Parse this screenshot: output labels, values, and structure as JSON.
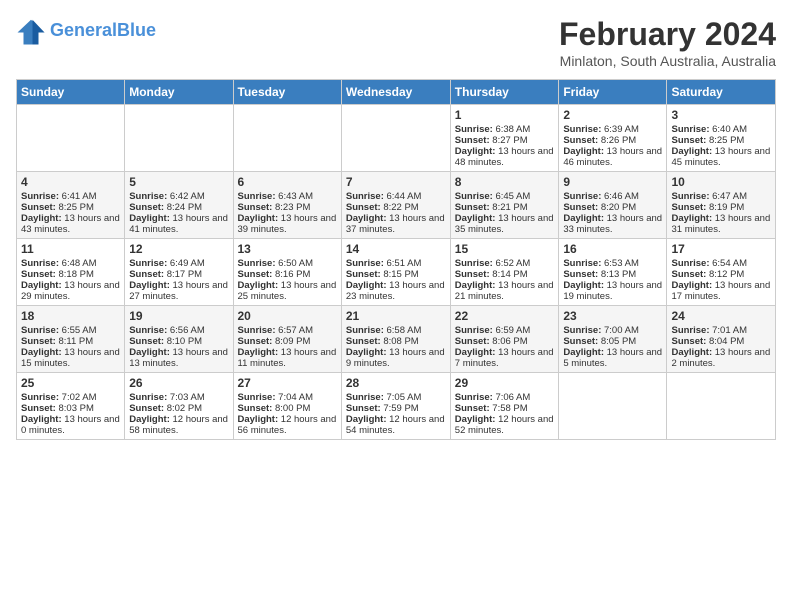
{
  "header": {
    "logo_line1": "General",
    "logo_line2": "Blue",
    "month": "February 2024",
    "location": "Minlaton, South Australia, Australia"
  },
  "days_of_week": [
    "Sunday",
    "Monday",
    "Tuesday",
    "Wednesday",
    "Thursday",
    "Friday",
    "Saturday"
  ],
  "weeks": [
    [
      {
        "day": "",
        "info": ""
      },
      {
        "day": "",
        "info": ""
      },
      {
        "day": "",
        "info": ""
      },
      {
        "day": "",
        "info": ""
      },
      {
        "day": "1",
        "info": "Sunrise: 6:38 AM\nSunset: 8:27 PM\nDaylight: 13 hours and 48 minutes."
      },
      {
        "day": "2",
        "info": "Sunrise: 6:39 AM\nSunset: 8:26 PM\nDaylight: 13 hours and 46 minutes."
      },
      {
        "day": "3",
        "info": "Sunrise: 6:40 AM\nSunset: 8:25 PM\nDaylight: 13 hours and 45 minutes."
      }
    ],
    [
      {
        "day": "4",
        "info": "Sunrise: 6:41 AM\nSunset: 8:25 PM\nDaylight: 13 hours and 43 minutes."
      },
      {
        "day": "5",
        "info": "Sunrise: 6:42 AM\nSunset: 8:24 PM\nDaylight: 13 hours and 41 minutes."
      },
      {
        "day": "6",
        "info": "Sunrise: 6:43 AM\nSunset: 8:23 PM\nDaylight: 13 hours and 39 minutes."
      },
      {
        "day": "7",
        "info": "Sunrise: 6:44 AM\nSunset: 8:22 PM\nDaylight: 13 hours and 37 minutes."
      },
      {
        "day": "8",
        "info": "Sunrise: 6:45 AM\nSunset: 8:21 PM\nDaylight: 13 hours and 35 minutes."
      },
      {
        "day": "9",
        "info": "Sunrise: 6:46 AM\nSunset: 8:20 PM\nDaylight: 13 hours and 33 minutes."
      },
      {
        "day": "10",
        "info": "Sunrise: 6:47 AM\nSunset: 8:19 PM\nDaylight: 13 hours and 31 minutes."
      }
    ],
    [
      {
        "day": "11",
        "info": "Sunrise: 6:48 AM\nSunset: 8:18 PM\nDaylight: 13 hours and 29 minutes."
      },
      {
        "day": "12",
        "info": "Sunrise: 6:49 AM\nSunset: 8:17 PM\nDaylight: 13 hours and 27 minutes."
      },
      {
        "day": "13",
        "info": "Sunrise: 6:50 AM\nSunset: 8:16 PM\nDaylight: 13 hours and 25 minutes."
      },
      {
        "day": "14",
        "info": "Sunrise: 6:51 AM\nSunset: 8:15 PM\nDaylight: 13 hours and 23 minutes."
      },
      {
        "day": "15",
        "info": "Sunrise: 6:52 AM\nSunset: 8:14 PM\nDaylight: 13 hours and 21 minutes."
      },
      {
        "day": "16",
        "info": "Sunrise: 6:53 AM\nSunset: 8:13 PM\nDaylight: 13 hours and 19 minutes."
      },
      {
        "day": "17",
        "info": "Sunrise: 6:54 AM\nSunset: 8:12 PM\nDaylight: 13 hours and 17 minutes."
      }
    ],
    [
      {
        "day": "18",
        "info": "Sunrise: 6:55 AM\nSunset: 8:11 PM\nDaylight: 13 hours and 15 minutes."
      },
      {
        "day": "19",
        "info": "Sunrise: 6:56 AM\nSunset: 8:10 PM\nDaylight: 13 hours and 13 minutes."
      },
      {
        "day": "20",
        "info": "Sunrise: 6:57 AM\nSunset: 8:09 PM\nDaylight: 13 hours and 11 minutes."
      },
      {
        "day": "21",
        "info": "Sunrise: 6:58 AM\nSunset: 8:08 PM\nDaylight: 13 hours and 9 minutes."
      },
      {
        "day": "22",
        "info": "Sunrise: 6:59 AM\nSunset: 8:06 PM\nDaylight: 13 hours and 7 minutes."
      },
      {
        "day": "23",
        "info": "Sunrise: 7:00 AM\nSunset: 8:05 PM\nDaylight: 13 hours and 5 minutes."
      },
      {
        "day": "24",
        "info": "Sunrise: 7:01 AM\nSunset: 8:04 PM\nDaylight: 13 hours and 2 minutes."
      }
    ],
    [
      {
        "day": "25",
        "info": "Sunrise: 7:02 AM\nSunset: 8:03 PM\nDaylight: 13 hours and 0 minutes."
      },
      {
        "day": "26",
        "info": "Sunrise: 7:03 AM\nSunset: 8:02 PM\nDaylight: 12 hours and 58 minutes."
      },
      {
        "day": "27",
        "info": "Sunrise: 7:04 AM\nSunset: 8:00 PM\nDaylight: 12 hours and 56 minutes."
      },
      {
        "day": "28",
        "info": "Sunrise: 7:05 AM\nSunset: 7:59 PM\nDaylight: 12 hours and 54 minutes."
      },
      {
        "day": "29",
        "info": "Sunrise: 7:06 AM\nSunset: 7:58 PM\nDaylight: 12 hours and 52 minutes."
      },
      {
        "day": "",
        "info": ""
      },
      {
        "day": "",
        "info": ""
      }
    ]
  ]
}
